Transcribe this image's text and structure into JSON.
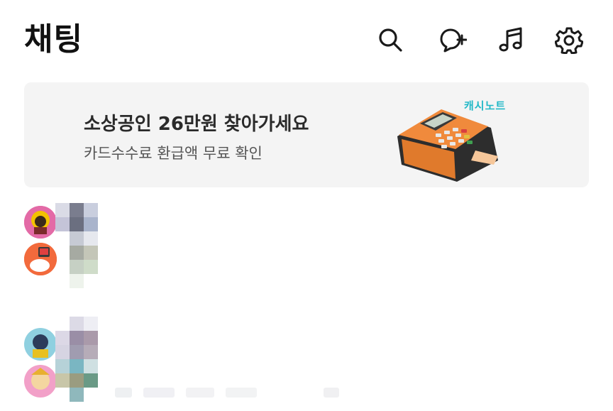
{
  "header": {
    "title": "채팅",
    "icons": [
      "search-icon",
      "new-chat-icon",
      "music-icon",
      "settings-icon"
    ]
  },
  "banner": {
    "headline": "소상공인 26만원 찾아가세요",
    "subtext": "카드수수료 환급액 무료 확인",
    "brand": "캐시노트",
    "colors": {
      "background": "#f4f4f4",
      "brand": "#22b8c7",
      "device": "#f08a3c"
    }
  },
  "chats": [
    {
      "avatars": [
        "character-avatar-1",
        "character-avatar-2"
      ]
    },
    {
      "avatars": [
        "character-avatar-3",
        "character-avatar-4"
      ]
    }
  ]
}
